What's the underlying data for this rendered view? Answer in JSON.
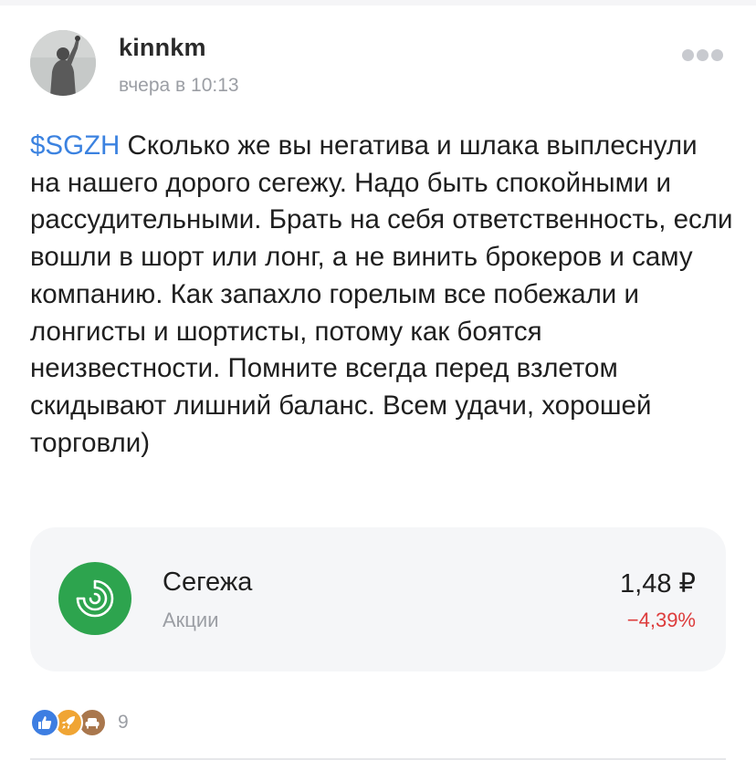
{
  "post": {
    "author": "kinnkm",
    "time": "вчера в 10:13",
    "ticker": "$SGZH",
    "text": " Сколько же вы негатива и шлака выплеснули на нашего дорого сегежу. Надо быть спокойными и рассудительными. Брать на себя ответственность, если вошли в шорт или лонг, а не винить брокеров и саму компанию. Как запахло горелым все побежали и лонгисты и шортисты, потому как боятся неизвестности. Помните всегда перед взлетом скидывают лишний баланс. Всем удачи, хорошей торговли)"
  },
  "stock": {
    "name": "Сегежа",
    "type": "Акции",
    "price": "1,48 ₽",
    "change": "−4,39%"
  },
  "reactions": {
    "count": "9",
    "icons": [
      "thumbs-up-icon",
      "rocket-icon",
      "sofa-icon"
    ]
  },
  "colors": {
    "ticker": "#3b82e0",
    "negative": "#dd3c3c",
    "stock_logo_bg": "#2da44e",
    "card_bg": "#f5f6f8"
  }
}
